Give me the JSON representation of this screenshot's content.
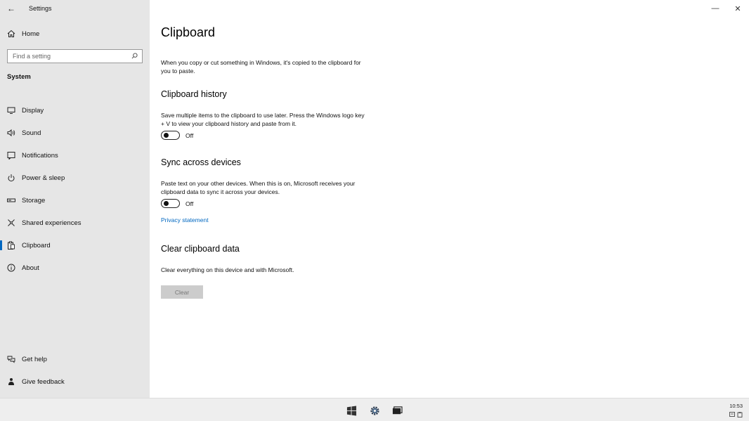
{
  "window": {
    "title": "Settings",
    "back_glyph": "←",
    "minimize_glyph": "—",
    "close_glyph": "✕"
  },
  "sidebar": {
    "home_label": "Home",
    "search_placeholder": "Find a setting",
    "section_title": "System",
    "items": [
      {
        "label": "Display",
        "icon": "monitor-icon"
      },
      {
        "label": "Sound",
        "icon": "speaker-icon"
      },
      {
        "label": "Notifications",
        "icon": "message-icon"
      },
      {
        "label": "Power & sleep",
        "icon": "power-icon"
      },
      {
        "label": "Storage",
        "icon": "storage-icon"
      },
      {
        "label": "Shared experiences",
        "icon": "shared-icon"
      },
      {
        "label": "Clipboard",
        "icon": "clipboard-icon",
        "active": true
      },
      {
        "label": "About",
        "icon": "info-icon"
      }
    ],
    "bottom_items": [
      {
        "label": "Get help",
        "icon": "help-icon"
      },
      {
        "label": "Give feedback",
        "icon": "feedback-icon"
      }
    ]
  },
  "main": {
    "title": "Clipboard",
    "intro": "When you copy or cut something in Windows, it's copied to the clipboard for you to paste.",
    "history": {
      "heading": "Clipboard history",
      "description": "Save multiple items to the clipboard to use later. Press the Windows logo key + V to view your clipboard history and paste from it.",
      "toggle_state": "Off"
    },
    "sync": {
      "heading": "Sync across devices",
      "description": "Paste text on your other devices. When this is on, Microsoft receives your clipboard data to sync it across your devices.",
      "toggle_state": "Off"
    },
    "privacy_link": "Privacy statement",
    "clear": {
      "heading": "Clear clipboard data",
      "description": "Clear everything on this device and with Microsoft.",
      "button_label": "Clear"
    }
  },
  "taskbar": {
    "time": "10:53",
    "accent_color": "#0067c0"
  }
}
